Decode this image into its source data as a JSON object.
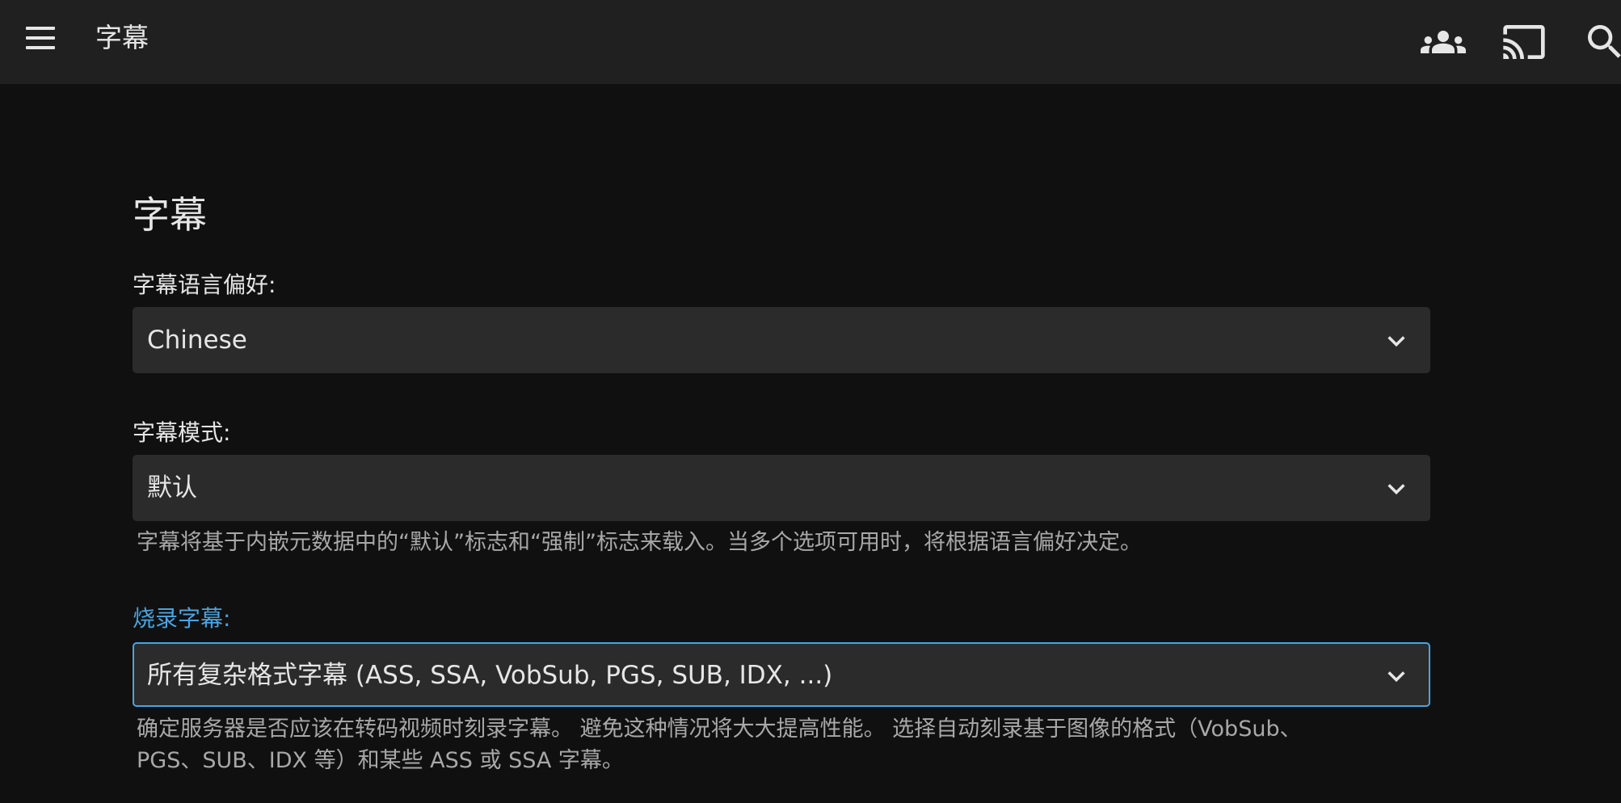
{
  "header": {
    "title": "字幕",
    "icons": [
      "menu-icon",
      "users-icon",
      "cast-icon",
      "search-icon"
    ]
  },
  "section": {
    "title": "字幕"
  },
  "fields": {
    "language": {
      "label": "字幕语言偏好:",
      "value": "Chinese"
    },
    "mode": {
      "label": "字幕模式:",
      "value": "默认",
      "help": "字幕将基于内嵌元数据中的“默认”标志和“强制”标志来载入。当多个选项可用时，将根据语言偏好决定。"
    },
    "burn": {
      "label": "烧录字幕:",
      "value": "所有复杂格式字幕 (ASS, SSA, VobSub, PGS, SUB, IDX, ...)",
      "help_line1": "确定服务器是否应该在转码视频时刻录字幕。 避免这种情况将大大提高性能。 选择自动刻录基于图像的格式（VobSub、",
      "help_line2": "PGS、SUB、IDX 等）和某些 ASS 或 SSA 字幕。"
    }
  },
  "colors": {
    "background": "#101010",
    "topbar": "#202020",
    "select": "#2b2b2b",
    "accent": "#4ba3e0",
    "help_text": "#a8a8a8"
  }
}
